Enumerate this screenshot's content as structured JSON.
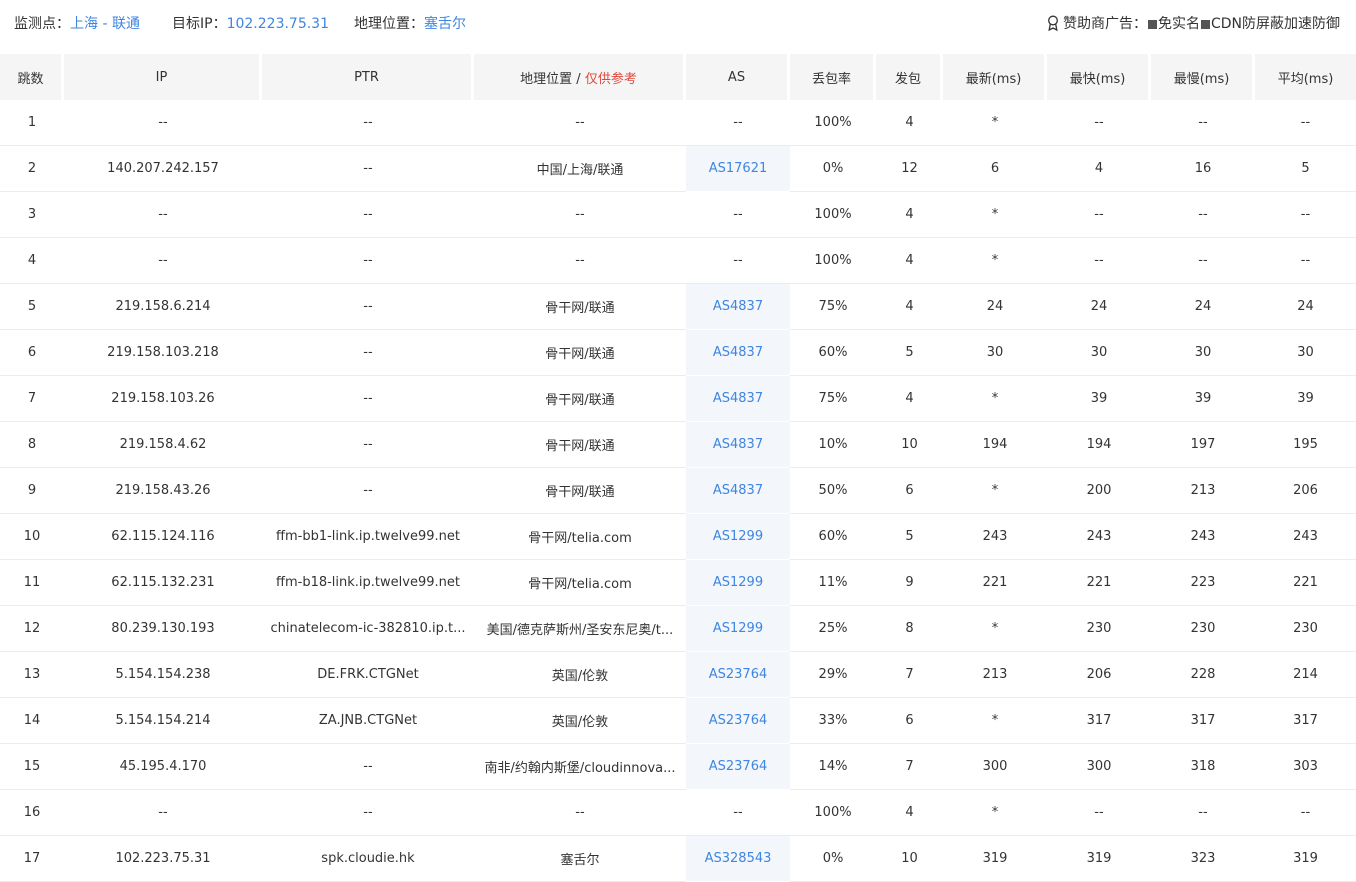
{
  "header": {
    "monitor_label": "监测点：",
    "monitor_value": "上海 - 联通",
    "target_label": "目标IP：",
    "target_value": "102.223.75.31",
    "geo_label": "地理位置：",
    "geo_value": "塞舌尔",
    "sponsor_label": "赞助商广告：",
    "sponsor_text_1": "免实名",
    "sponsor_text_2": "CDN防屏蔽加速防御",
    "sponsor_icon": "medal-icon"
  },
  "columns": {
    "hop": "跳数",
    "ip": "IP",
    "ptr": "PTR",
    "geo": "地理位置 / ",
    "geo_ref": "仅供参考",
    "as": "AS",
    "loss": "丢包率",
    "sent": "发包",
    "last": "最新(ms)",
    "best": "最快(ms)",
    "worst": "最慢(ms)",
    "avg": "平均(ms)"
  },
  "rows": [
    {
      "hop": "1",
      "ip": "--",
      "ptr": "--",
      "geo": "--",
      "as": "--",
      "loss": "100%",
      "sent": "4",
      "last": "*",
      "best": "--",
      "worst": "--",
      "avg": "--"
    },
    {
      "hop": "2",
      "ip": "140.207.242.157",
      "ptr": "--",
      "geo": "中国/上海/联通",
      "as": "AS17621",
      "loss": "0%",
      "sent": "12",
      "last": "6",
      "best": "4",
      "worst": "16",
      "avg": "5"
    },
    {
      "hop": "3",
      "ip": "--",
      "ptr": "--",
      "geo": "--",
      "as": "--",
      "loss": "100%",
      "sent": "4",
      "last": "*",
      "best": "--",
      "worst": "--",
      "avg": "--"
    },
    {
      "hop": "4",
      "ip": "--",
      "ptr": "--",
      "geo": "--",
      "as": "--",
      "loss": "100%",
      "sent": "4",
      "last": "*",
      "best": "--",
      "worst": "--",
      "avg": "--"
    },
    {
      "hop": "5",
      "ip": "219.158.6.214",
      "ptr": "--",
      "geo": "骨干网/联通",
      "as": "AS4837",
      "loss": "75%",
      "sent": "4",
      "last": "24",
      "best": "24",
      "worst": "24",
      "avg": "24"
    },
    {
      "hop": "6",
      "ip": "219.158.103.218",
      "ptr": "--",
      "geo": "骨干网/联通",
      "as": "AS4837",
      "loss": "60%",
      "sent": "5",
      "last": "30",
      "best": "30",
      "worst": "30",
      "avg": "30"
    },
    {
      "hop": "7",
      "ip": "219.158.103.26",
      "ptr": "--",
      "geo": "骨干网/联通",
      "as": "AS4837",
      "loss": "75%",
      "sent": "4",
      "last": "*",
      "best": "39",
      "worst": "39",
      "avg": "39"
    },
    {
      "hop": "8",
      "ip": "219.158.4.62",
      "ptr": "--",
      "geo": "骨干网/联通",
      "as": "AS4837",
      "loss": "10%",
      "sent": "10",
      "last": "194",
      "best": "194",
      "worst": "197",
      "avg": "195"
    },
    {
      "hop": "9",
      "ip": "219.158.43.26",
      "ptr": "--",
      "geo": "骨干网/联通",
      "as": "AS4837",
      "loss": "50%",
      "sent": "6",
      "last": "*",
      "best": "200",
      "worst": "213",
      "avg": "206"
    },
    {
      "hop": "10",
      "ip": "62.115.124.116",
      "ptr": "ffm-bb1-link.ip.twelve99.net",
      "geo": "骨干网/telia.com",
      "as": "AS1299",
      "loss": "60%",
      "sent": "5",
      "last": "243",
      "best": "243",
      "worst": "243",
      "avg": "243"
    },
    {
      "hop": "11",
      "ip": "62.115.132.231",
      "ptr": "ffm-b18-link.ip.twelve99.net",
      "geo": "骨干网/telia.com",
      "as": "AS1299",
      "loss": "11%",
      "sent": "9",
      "last": "221",
      "best": "221",
      "worst": "223",
      "avg": "221"
    },
    {
      "hop": "12",
      "ip": "80.239.130.193",
      "ptr": "chinatelecom-ic-382810.ip.t...",
      "geo": "美国/德克萨斯州/圣安东尼奥/t...",
      "as": "AS1299",
      "loss": "25%",
      "sent": "8",
      "last": "*",
      "best": "230",
      "worst": "230",
      "avg": "230"
    },
    {
      "hop": "13",
      "ip": "5.154.154.238",
      "ptr": "DE.FRK.CTGNet",
      "geo": "英国/伦敦",
      "as": "AS23764",
      "loss": "29%",
      "sent": "7",
      "last": "213",
      "best": "206",
      "worst": "228",
      "avg": "214"
    },
    {
      "hop": "14",
      "ip": "5.154.154.214",
      "ptr": "ZA.JNB.CTGNet",
      "geo": "英国/伦敦",
      "as": "AS23764",
      "loss": "33%",
      "sent": "6",
      "last": "*",
      "best": "317",
      "worst": "317",
      "avg": "317"
    },
    {
      "hop": "15",
      "ip": "45.195.4.170",
      "ptr": "--",
      "geo": "南非/约翰内斯堡/cloudinnova...",
      "as": "AS23764",
      "loss": "14%",
      "sent": "7",
      "last": "300",
      "best": "300",
      "worst": "318",
      "avg": "303"
    },
    {
      "hop": "16",
      "ip": "--",
      "ptr": "--",
      "geo": "--",
      "as": "--",
      "loss": "100%",
      "sent": "4",
      "last": "*",
      "best": "--",
      "worst": "--",
      "avg": "--"
    },
    {
      "hop": "17",
      "ip": "102.223.75.31",
      "ptr": "spk.cloudie.hk",
      "geo": "塞舌尔",
      "as": "AS328543",
      "loss": "0%",
      "sent": "10",
      "last": "319",
      "best": "319",
      "worst": "323",
      "avg": "319"
    }
  ],
  "colors": {
    "link": "#3e86e0",
    "reference": "#e2483d",
    "header_bg": "#f5f5f5",
    "as_cell_bg": "#f3f6fb"
  }
}
